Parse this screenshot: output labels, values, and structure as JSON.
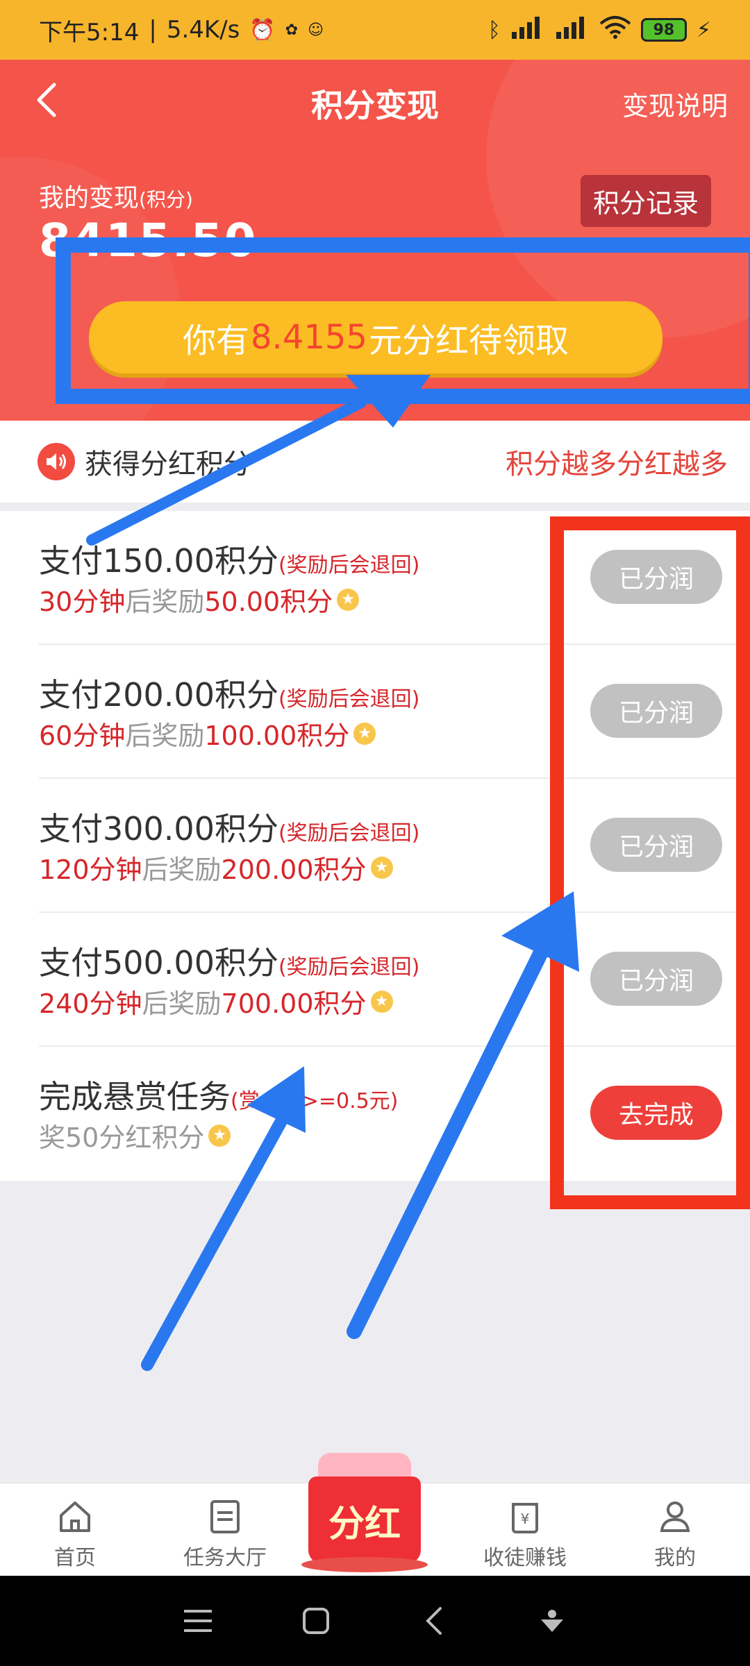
{
  "status_bar": {
    "time": "下午5:14",
    "speed": "5.4K/s",
    "battery": "98",
    "icons": [
      "alarm-icon",
      "bluetooth-icon",
      "signal-icon",
      "wifi-icon",
      "battery-icon",
      "charging-icon"
    ]
  },
  "header": {
    "title": "积分变现",
    "explain": "变现说明",
    "my_label": "我的变现",
    "my_label_unit": "(积分)",
    "my_value": "8415.50",
    "record_button": "积分记录",
    "claim_prefix": "你有",
    "claim_amount": "8.4155",
    "claim_suffix": "元分红待领取"
  },
  "notice": {
    "left": "获得分红积分",
    "right": "积分越多分红越多"
  },
  "tasks": [
    {
      "title": "支付150.00积分",
      "note": "(奖励后会退回)",
      "time": "30分钟",
      "mid": "后奖励",
      "reward": "50.00积分",
      "button": "已分润"
    },
    {
      "title": "支付200.00积分",
      "note": "(奖励后会退回)",
      "time": "60分钟",
      "mid": "后奖励",
      "reward": "100.00积分",
      "button": "已分润"
    },
    {
      "title": "支付300.00积分",
      "note": "(奖励后会退回)",
      "time": "120分钟",
      "mid": "后奖励",
      "reward": "200.00积分",
      "button": "已分润"
    },
    {
      "title": "支付500.00积分",
      "note": "(奖励后会退回)",
      "time": "240分钟",
      "mid": "后奖励",
      "reward": "700.00积分",
      "button": "已分润"
    },
    {
      "title": "完成悬赏任务",
      "note": "(赏金需>=0.5元)",
      "sub": "奖50分红积分",
      "button": "去完成"
    }
  ],
  "bottom_nav": {
    "items": [
      {
        "label": "首页",
        "icon": "home-icon"
      },
      {
        "label": "任务大厅",
        "icon": "task-list-icon"
      },
      {
        "label": "分红",
        "icon": "red-envelope-icon"
      },
      {
        "label": "收徒赚钱",
        "icon": "money-jar-icon"
      },
      {
        "label": "我的",
        "icon": "user-icon"
      }
    ]
  },
  "colors": {
    "status_bar": "#f7b52c",
    "header": "#f4544a",
    "claim_button": "#fbbd23",
    "accent_red": "#d6262a",
    "annotation_blue": "#2a78f0",
    "annotation_red": "#f2341c"
  }
}
